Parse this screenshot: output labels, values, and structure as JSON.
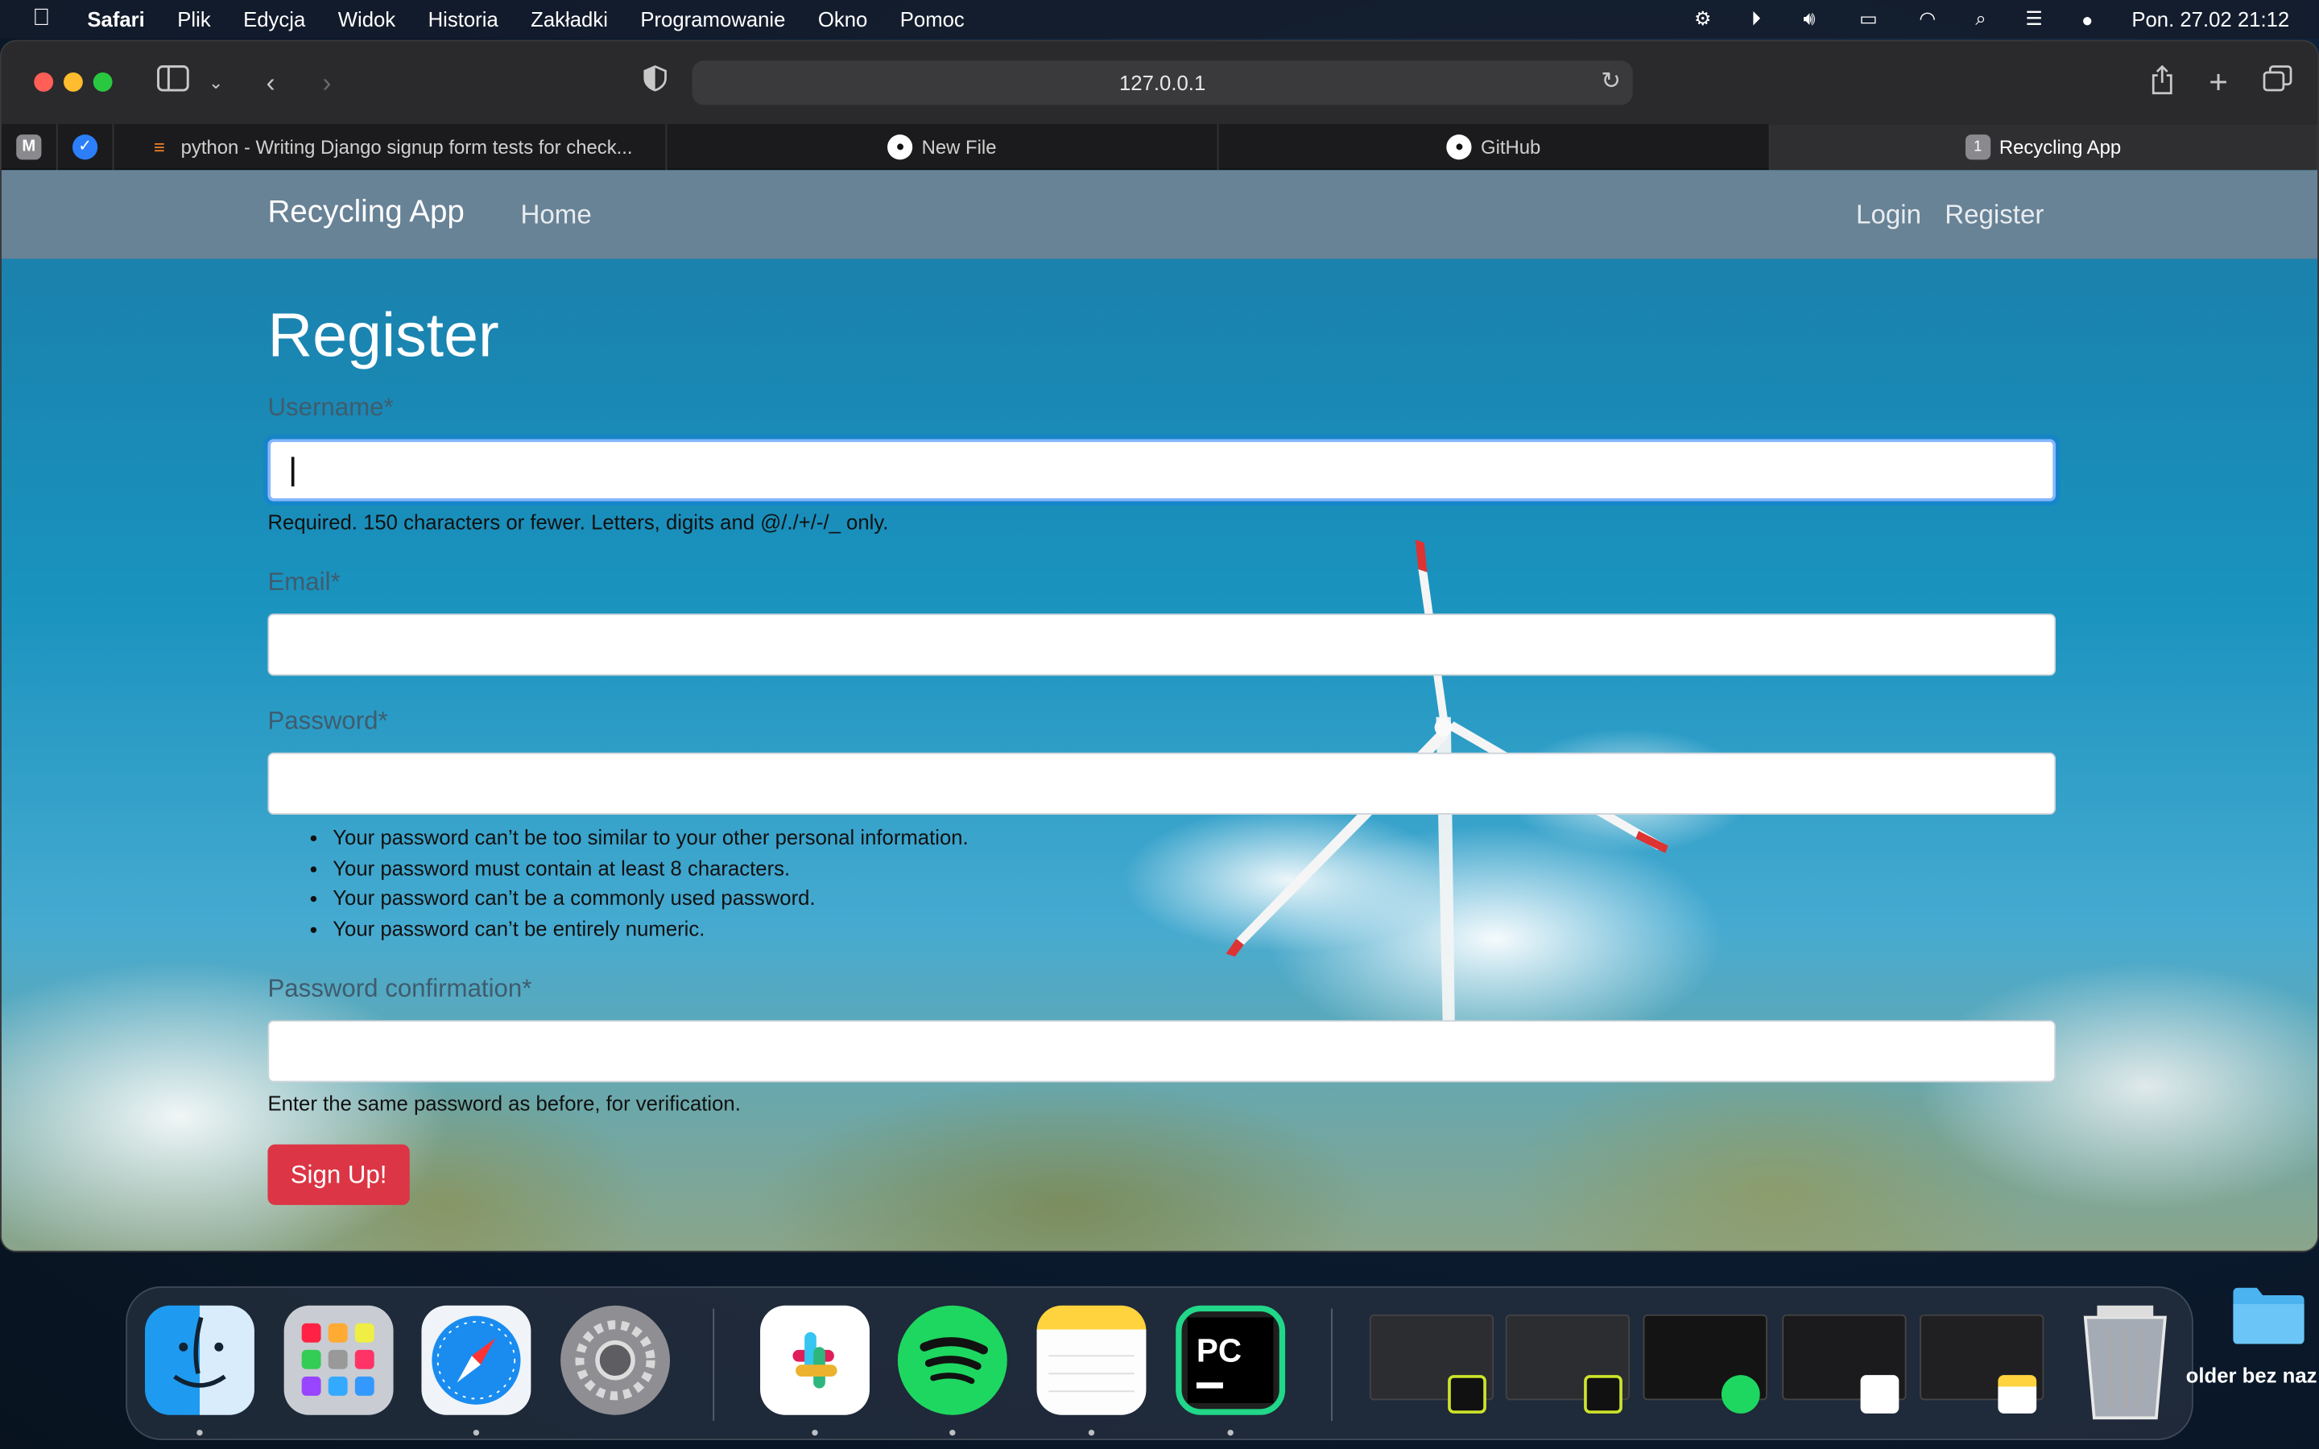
{
  "menubar": {
    "apple": "",
    "app_name": "Safari",
    "menus": [
      "Plik",
      "Edycja",
      "Widok",
      "Historia",
      "Zakładki",
      "Programowanie",
      "Okno",
      "Pomoc"
    ],
    "clock": "Pon. 27.02  21:12"
  },
  "browser": {
    "url": "127.0.0.1",
    "pinned_tabs": [
      "M",
      "✓"
    ],
    "tabs": [
      {
        "title": "python - Writing Django signup form tests for check...",
        "icon": "stackoverflow-icon"
      },
      {
        "title": "New File",
        "icon": "github-icon"
      },
      {
        "title": "GitHub",
        "icon": "github-icon"
      },
      {
        "title": "Recycling App",
        "icon": "number-badge-icon",
        "badge": "1",
        "active": true
      }
    ]
  },
  "site": {
    "brand": "Recycling App",
    "nav_home": "Home",
    "nav_login": "Login",
    "nav_register": "Register"
  },
  "form": {
    "title": "Register",
    "username_label": "Username*",
    "username_help": "Required. 150 characters or fewer. Letters, digits and @/./+/-/_ only.",
    "email_label": "Email*",
    "password_label": "Password*",
    "password_help": [
      "Your password can’t be too similar to your other personal information.",
      "Your password must contain at least 8 characters.",
      "Your password can’t be a commonly used password.",
      "Your password can’t be entirely numeric."
    ],
    "password2_label": "Password confirmation*",
    "password2_help": "Enter the same password as before, for verification.",
    "submit": "Sign Up!"
  },
  "desktop": {
    "folder_label": "older bez naz"
  },
  "colors": {
    "navbar": "#6e8294",
    "submit": "#dc3545",
    "focus_ring": "#86b7fe"
  }
}
